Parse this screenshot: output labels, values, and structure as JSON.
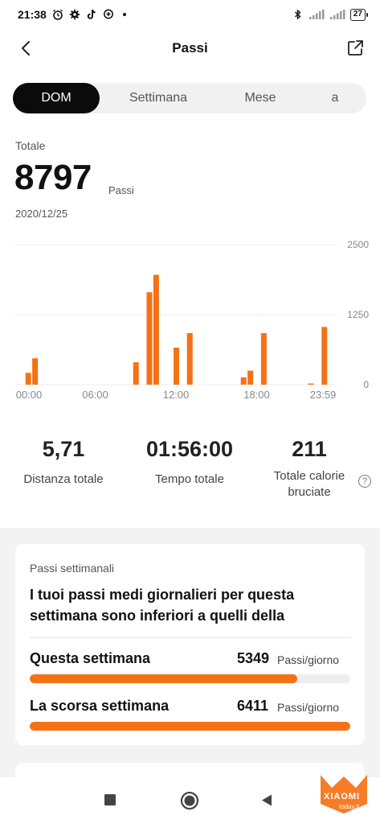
{
  "status_bar": {
    "time": "21:38",
    "battery": "27",
    "icons": [
      "alarm-icon",
      "gear-icon",
      "tiktok-icon",
      "location-plus-icon",
      "bluetooth-icon",
      "signal-icon",
      "signal-icon-2",
      "battery-icon"
    ]
  },
  "header": {
    "title": "Passi",
    "back_icon": "chevron-left-icon",
    "share_icon": "share-export-icon"
  },
  "tabs": [
    {
      "label": "DOM",
      "active": true
    },
    {
      "label": "Settimana",
      "active": false
    },
    {
      "label": "Mese",
      "active": false
    },
    {
      "label": "a",
      "active": false
    }
  ],
  "summary": {
    "label": "Totale",
    "value": "8797",
    "unit": "Passi",
    "date": "2020/12/25"
  },
  "chart_data": {
    "type": "bar",
    "x_tick_labels": [
      "00:00",
      "06:00",
      "12:00",
      "18:00",
      "23:59"
    ],
    "y_tick_labels": [
      "2500",
      "1250",
      "0"
    ],
    "ylim": [
      0,
      2500
    ],
    "bar_color": "#f47216",
    "grid": true,
    "bins": [
      {
        "x": "01:00",
        "value": 210
      },
      {
        "x": "01:30",
        "value": 470
      },
      {
        "x": "09:00",
        "value": 400
      },
      {
        "x": "10:00",
        "value": 1650
      },
      {
        "x": "10:30",
        "value": 1960
      },
      {
        "x": "12:00",
        "value": 660
      },
      {
        "x": "13:00",
        "value": 920
      },
      {
        "x": "17:00",
        "value": 130
      },
      {
        "x": "17:30",
        "value": 250
      },
      {
        "x": "18:30",
        "value": 920
      },
      {
        "x": "22:00",
        "value": 20
      },
      {
        "x": "23:00",
        "value": 1030
      }
    ]
  },
  "stats": [
    {
      "value": "5,71",
      "label": "Distanza totale"
    },
    {
      "value": "01:56:00",
      "label": "Tempo totale"
    },
    {
      "value": "211",
      "label": "Totale calorie bruciate"
    }
  ],
  "weekly": {
    "title": "Passi settimanali",
    "message": "I tuoi passi medi giornalieri per questa settimana sono inferiori a quelli della",
    "rows": [
      {
        "label": "Questa settimana",
        "value": "5349",
        "unit": "Passi/giorno",
        "fraction": 0.834
      },
      {
        "label": "La scorsa settimana",
        "value": "6411",
        "unit": "Passi/giorno",
        "fraction": 1.0
      }
    ]
  },
  "watermark": {
    "brand": "XIAOMI",
    "sub": "today.it"
  },
  "colors": {
    "accent": "#f47216",
    "active_tab": "#0b0b0b",
    "gray_bg": "#f3f3f3"
  }
}
